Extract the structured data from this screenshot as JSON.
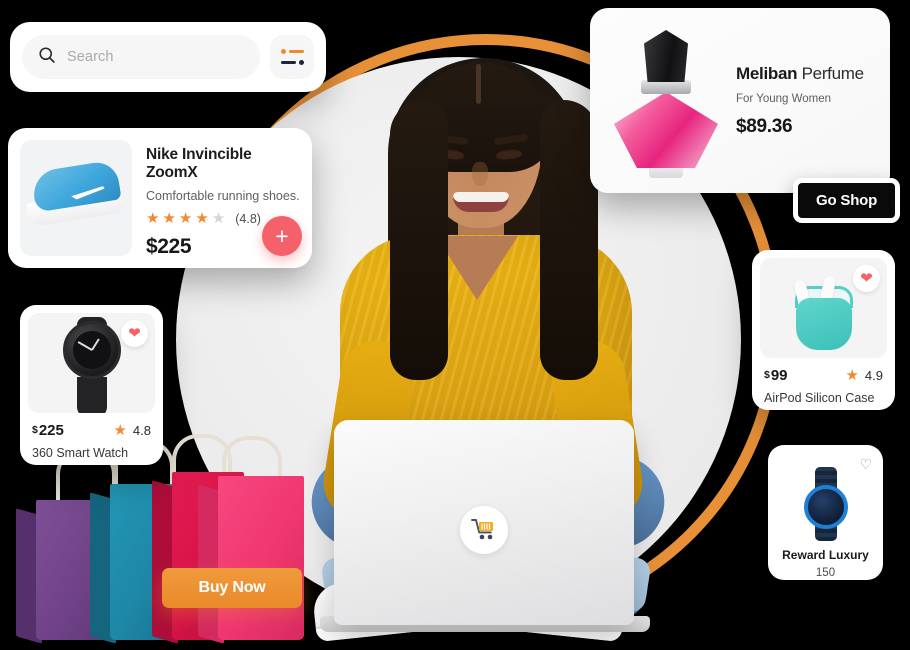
{
  "search": {
    "placeholder": "Search",
    "icon": "search-icon",
    "filter_icon": "filter-sliders-icon",
    "filter_accent": "#EE8B2E",
    "filter_dark": "#20223F"
  },
  "nike_card": {
    "title": "Nike Invincible ZoomX",
    "subtitle": "Comfortable running shoes.",
    "rating_label": "(4.8)",
    "stars_filled": 4,
    "stars_total": 5,
    "price": "$225",
    "add_button": "+",
    "product_image": "blue-nike-running-shoe",
    "accent": "#F4616A",
    "star_color": "#F08A30"
  },
  "watch_card": {
    "price": "225",
    "currency": "$",
    "rating": "4.8",
    "name": "360 Smart Watch",
    "favorite_icon": "heart-filled-icon",
    "favorite_state": "filled",
    "product_image": "black-smart-watch"
  },
  "airpod_card": {
    "price": "99",
    "currency": "$",
    "rating": "4.9",
    "name": "AirPod Silicon Case",
    "favorite_icon": "heart-filled-icon",
    "favorite_state": "filled",
    "product_image": "teal-airpod-silicon-case"
  },
  "reward_card": {
    "title": "Reward Luxury",
    "points": "150",
    "favorite_icon": "heart-outline-icon",
    "favorite_state": "outline",
    "product_image": "blue-chronograph-watch"
  },
  "perfume_card": {
    "brand": "Meliban",
    "category": "Perfume",
    "subtitle": "For Young Women",
    "price": "$89.36",
    "product_image": "pink-crystal-perfume-bottle"
  },
  "go_shop_button": {
    "label": "Go Shop",
    "background": "#0A0A0A"
  },
  "buy_now_button": {
    "label": "Buy Now",
    "background": "#E98A2B"
  },
  "hero": {
    "laptop_badge_icon": "shopping-cart-icon",
    "person_alt": "woman-with-laptop",
    "ring_color": "#E79038",
    "circle_color": "#ECECED"
  },
  "shopping_bags": {
    "alt": "shopping-bags",
    "colors": [
      "#6F4287",
      "#1E87A6",
      "#D51347",
      "#EF3671"
    ]
  },
  "theme": {
    "background": "#000000",
    "card_background": "#FFFFFF",
    "accent_orange": "#E98A2B",
    "accent_coral": "#F4616A"
  }
}
